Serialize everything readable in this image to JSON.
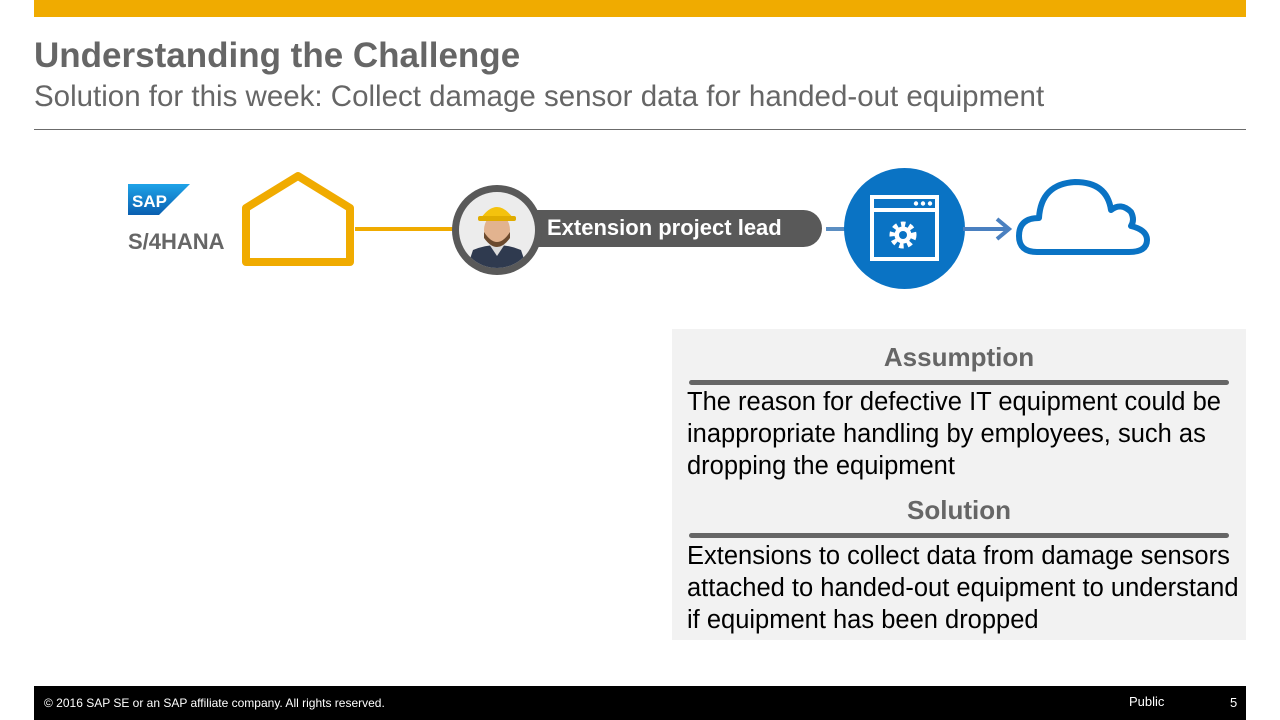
{
  "header": {
    "title": "Understanding the Challenge",
    "subtitle": "Solution for this week: Collect damage sensor data for handed-out equipment"
  },
  "diagram": {
    "sap_logo_text": "SAP",
    "system_label": "S/4HANA",
    "person_label": "Extension project lead",
    "icons": [
      "sap-logo",
      "house-icon",
      "person-photo",
      "app-gear-icon",
      "arrow-right-icon",
      "cloud-icon"
    ]
  },
  "panel": {
    "assumption_heading": "Assumption",
    "assumption_text": "The reason for defective IT equipment could be inappropriate handling by employees, such as dropping the equipment",
    "solution_heading": "Solution",
    "solution_text": "Extensions to collect data from damage sensors attached to handed-out equipment to understand if equipment has been dropped"
  },
  "footer": {
    "copyright": "© 2016 SAP SE or an SAP affiliate company. All rights reserved.",
    "classification": "Public",
    "page_number": "5"
  },
  "colors": {
    "accent_gold": "#f0ab00",
    "sap_blue": "#0a73c4",
    "text_gray": "#666666",
    "panel_bg": "#f2f2f2"
  }
}
